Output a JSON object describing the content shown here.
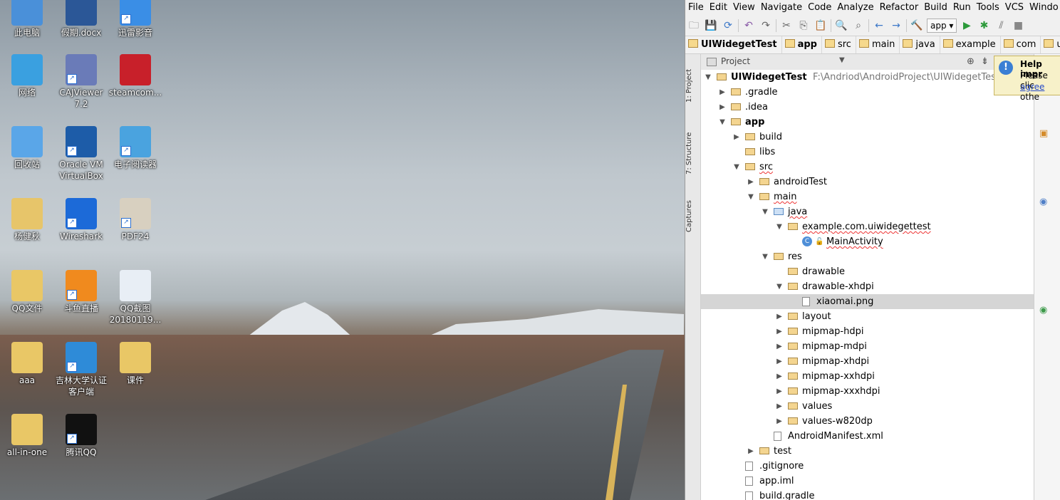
{
  "desktop": {
    "icons": [
      {
        "label": "此电脑",
        "icon": "computer-icon",
        "color": "#4a90d9",
        "shortcut": false
      },
      {
        "label": "假期.docx",
        "icon": "word-doc-icon",
        "color": "#2b5797",
        "shortcut": false
      },
      {
        "label": "迅雷影音",
        "icon": "thunder-player-icon",
        "color": "#3a8ee6",
        "shortcut": true
      },
      {
        "label": "网络",
        "icon": "network-icon",
        "color": "#3aa0e0",
        "shortcut": false
      },
      {
        "label": "CAJViewer 7.2",
        "icon": "cajviewer-icon",
        "color": "#6a7bb8",
        "shortcut": true
      },
      {
        "label": "steamcom...",
        "icon": "steamcommunity-icon",
        "color": "#c8202a",
        "shortcut": false
      },
      {
        "label": "回收站",
        "icon": "recycle-bin-icon",
        "color": "#5aa6e8",
        "shortcut": false
      },
      {
        "label": "Oracle VM VirtualBox",
        "icon": "virtualbox-icon",
        "color": "#1d5ca8",
        "shortcut": true
      },
      {
        "label": "电子阅读器",
        "icon": "cef-reader-icon",
        "color": "#4aa3df",
        "shortcut": true
      },
      {
        "label": "杨健秋",
        "icon": "user-folder-icon",
        "color": "#e7c56a",
        "shortcut": false
      },
      {
        "label": "Wireshark",
        "icon": "wireshark-icon",
        "color": "#1c6ad8",
        "shortcut": true
      },
      {
        "label": "PDF24",
        "icon": "pdf24-icon",
        "color": "#d8d0c0",
        "shortcut": true
      },
      {
        "label": "QQ文件",
        "icon": "folder-icon",
        "color": "#e9c766",
        "shortcut": false
      },
      {
        "label": "斗鱼直播",
        "icon": "douyu-icon",
        "color": "#f08a1e",
        "shortcut": true
      },
      {
        "label": "QQ截图 20180119...",
        "icon": "screenshot-image-icon",
        "color": "#e8eef5",
        "shortcut": false
      },
      {
        "label": "aaa",
        "icon": "folder-icon",
        "color": "#e9c766",
        "shortcut": false
      },
      {
        "label": "吉林大学认证客户端",
        "icon": "jlu-client-icon",
        "color": "#2e8bd8",
        "shortcut": true
      },
      {
        "label": "课件",
        "icon": "pdf-folder-icon",
        "color": "#e9c766",
        "shortcut": false
      },
      {
        "label": "all-in-one",
        "icon": "archive-icon",
        "color": "#e9c766",
        "shortcut": false
      },
      {
        "label": "腾讯QQ",
        "icon": "qq-penguin-icon",
        "color": "#111111",
        "shortcut": true
      }
    ]
  },
  "ide": {
    "menu": [
      "File",
      "Edit",
      "View",
      "Navigate",
      "Code",
      "Analyze",
      "Refactor",
      "Build",
      "Run",
      "Tools",
      "VCS",
      "Windo"
    ],
    "toolbar": {
      "run_config": "app",
      "icons": [
        "open-folder-icon",
        "save-icon",
        "sync-icon",
        "undo-icon",
        "redo-icon",
        "cut-icon",
        "copy-icon",
        "paste-icon",
        "find-icon",
        "replace-icon",
        "back-icon",
        "forward-icon",
        "make-icon",
        "run-icon",
        "debug-icon",
        "profile-icon",
        "stop-icon"
      ]
    },
    "breadcrumb": [
      "UIWidegetTest",
      "app",
      "src",
      "main",
      "java",
      "example",
      "com",
      "uiw"
    ],
    "side_tabs": [
      "1: Project",
      "7: Structure",
      "Captures"
    ],
    "panel": {
      "title": "Project"
    },
    "tree": [
      {
        "depth": 0,
        "arrow": "down",
        "type": "module",
        "label": "UIWidegetTest",
        "bold": true,
        "path": "F:\\Andriod\\AndroidProject\\UIWidegetTest"
      },
      {
        "depth": 1,
        "arrow": "right",
        "type": "folder",
        "label": ".gradle"
      },
      {
        "depth": 1,
        "arrow": "right",
        "type": "folder",
        "label": ".idea"
      },
      {
        "depth": 1,
        "arrow": "down",
        "type": "folder",
        "label": "app",
        "bold": true
      },
      {
        "depth": 2,
        "arrow": "right",
        "type": "folder",
        "label": "build"
      },
      {
        "depth": 2,
        "arrow": "",
        "type": "folder",
        "label": "libs"
      },
      {
        "depth": 2,
        "arrow": "down",
        "type": "folder",
        "label": "src",
        "squiggle": true
      },
      {
        "depth": 3,
        "arrow": "right",
        "type": "folder",
        "label": "androidTest"
      },
      {
        "depth": 3,
        "arrow": "down",
        "type": "folder",
        "label": "main",
        "squiggle": true
      },
      {
        "depth": 4,
        "arrow": "down",
        "type": "folder-blue",
        "label": "java",
        "squiggle": true
      },
      {
        "depth": 5,
        "arrow": "down",
        "type": "package",
        "label": "example.com.uiwidegettest",
        "squiggle": true
      },
      {
        "depth": 6,
        "arrow": "",
        "type": "class",
        "label": "MainActivity",
        "squiggle": true
      },
      {
        "depth": 4,
        "arrow": "down",
        "type": "folder-res",
        "label": "res"
      },
      {
        "depth": 5,
        "arrow": "",
        "type": "folder",
        "label": "drawable"
      },
      {
        "depth": 5,
        "arrow": "down",
        "type": "folder",
        "label": "drawable-xhdpi"
      },
      {
        "depth": 6,
        "arrow": "",
        "type": "file",
        "label": "xiaomai.png",
        "selected": true
      },
      {
        "depth": 5,
        "arrow": "right",
        "type": "folder",
        "label": "layout"
      },
      {
        "depth": 5,
        "arrow": "right",
        "type": "folder",
        "label": "mipmap-hdpi"
      },
      {
        "depth": 5,
        "arrow": "right",
        "type": "folder",
        "label": "mipmap-mdpi"
      },
      {
        "depth": 5,
        "arrow": "right",
        "type": "folder",
        "label": "mipmap-xhdpi"
      },
      {
        "depth": 5,
        "arrow": "right",
        "type": "folder",
        "label": "mipmap-xxhdpi"
      },
      {
        "depth": 5,
        "arrow": "right",
        "type": "folder",
        "label": "mipmap-xxxhdpi"
      },
      {
        "depth": 5,
        "arrow": "right",
        "type": "folder",
        "label": "values"
      },
      {
        "depth": 5,
        "arrow": "right",
        "type": "folder",
        "label": "values-w820dp"
      },
      {
        "depth": 4,
        "arrow": "",
        "type": "file",
        "label": "AndroidManifest.xml"
      },
      {
        "depth": 3,
        "arrow": "right",
        "type": "folder",
        "label": "test"
      },
      {
        "depth": 2,
        "arrow": "",
        "type": "file",
        "label": ".gitignore"
      },
      {
        "depth": 2,
        "arrow": "",
        "type": "file",
        "label": "app.iml"
      },
      {
        "depth": 2,
        "arrow": "",
        "type": "file",
        "label": "build.gradle"
      }
    ],
    "notification": {
      "title": "Help impr",
      "line1": "Please clic",
      "link": "agree",
      "line2_rest": " othe"
    }
  }
}
